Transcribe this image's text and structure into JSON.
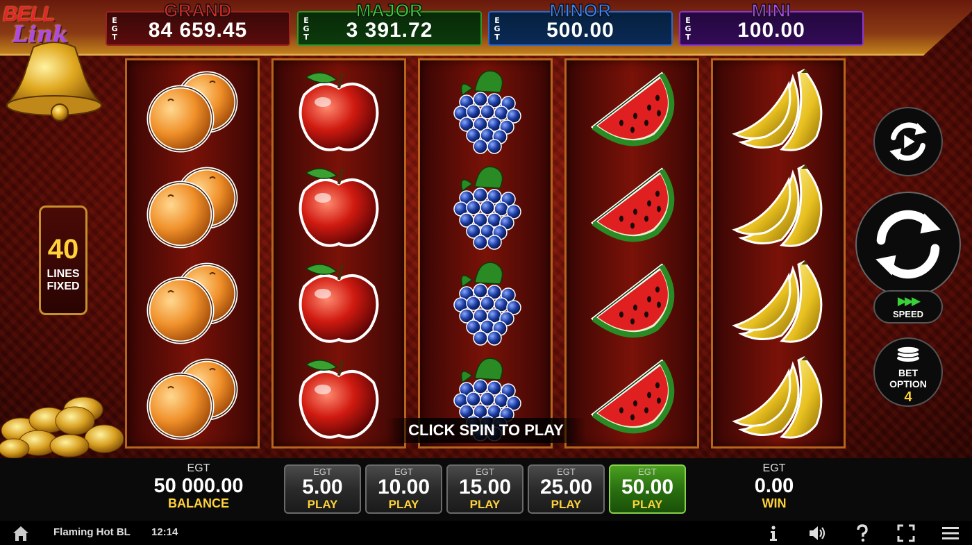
{
  "logo": {
    "line1": "BELL",
    "line2": "Link"
  },
  "jackpots": [
    {
      "name": "GRAND",
      "egt": "EGT",
      "value": "84 659.45"
    },
    {
      "name": "MAJOR",
      "egt": "EGT",
      "value": "3 391.72"
    },
    {
      "name": "MINOR",
      "egt": "EGT",
      "value": "500.00"
    },
    {
      "name": "MINI",
      "egt": "EGT",
      "value": "100.00"
    }
  ],
  "reels": [
    {
      "symbol": "peach",
      "rows": 4
    },
    {
      "symbol": "apple",
      "rows": 4
    },
    {
      "symbol": "grapes",
      "rows": 4
    },
    {
      "symbol": "watermelon",
      "rows": 4
    },
    {
      "symbol": "banana",
      "rows": 4
    }
  ],
  "lines": {
    "count": "40",
    "line1": "LINES",
    "line2": "FIXED"
  },
  "controls": {
    "autoplay_icon": "autoplay-icon",
    "spin_icon": "spin-icon",
    "speed_label": "SPEED",
    "bet_option_line1": "BET",
    "bet_option_line2": "OPTION",
    "bet_option_value": "4"
  },
  "message": "CLICK SPIN TO PLAY",
  "balance": {
    "egt": "EGT",
    "value": "50 000.00",
    "label": "BALANCE"
  },
  "win": {
    "egt": "EGT",
    "value": "0.00",
    "label": "WIN"
  },
  "bets": [
    {
      "egt": "EGT",
      "value": "5.00",
      "label": "PLAY",
      "active": false
    },
    {
      "egt": "EGT",
      "value": "10.00",
      "label": "PLAY",
      "active": false
    },
    {
      "egt": "EGT",
      "value": "15.00",
      "label": "PLAY",
      "active": false
    },
    {
      "egt": "EGT",
      "value": "25.00",
      "label": "PLAY",
      "active": false
    },
    {
      "egt": "EGT",
      "value": "50.00",
      "label": "PLAY",
      "active": true
    }
  ],
  "status": {
    "game_name": "Flaming Hot BL",
    "time": "12:14",
    "icons": [
      "home-icon",
      "info-icon",
      "sound-icon",
      "help-icon",
      "fullscreen-icon",
      "menu-icon"
    ]
  },
  "colors": {
    "grand": "#e02828",
    "major": "#34d034",
    "minor": "#3a84ff",
    "mini": "#b04cf0",
    "accent_gold": "#ffd23a",
    "active_bet": "#4aa020"
  }
}
